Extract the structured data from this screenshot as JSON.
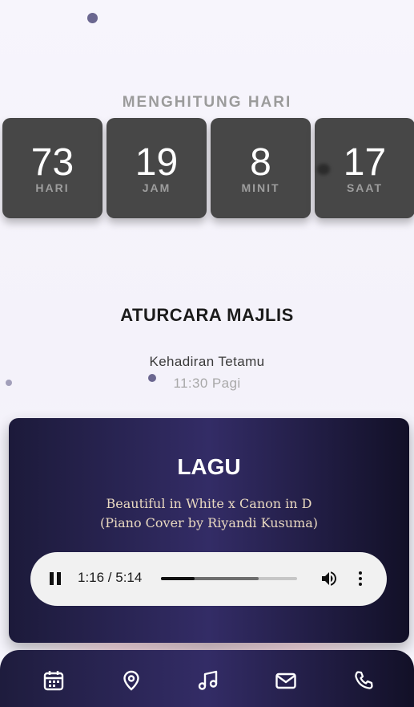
{
  "countdown": {
    "title": "MENGHITUNG HARI",
    "units": [
      {
        "value": "73",
        "label": "HARI"
      },
      {
        "value": "19",
        "label": "JAM"
      },
      {
        "value": "8",
        "label": "MINIT"
      },
      {
        "value": "17",
        "label": "SAAT"
      }
    ]
  },
  "schedule": {
    "title": "ATURCARA MAJLIS",
    "event_name": "Kehadiran Tetamu",
    "event_time": "11:30 Pagi"
  },
  "music": {
    "title": "LAGU",
    "song_line1": "Beautiful in White x Canon in D",
    "song_line2": "(Piano Cover by Riyandi Kusuma)",
    "time_display": "1:16 / 5:14",
    "progress": 0.245,
    "buffered": 0.72
  },
  "bottom_nav": {
    "items": [
      "calendar-icon",
      "location-pin-icon",
      "music-note-icon",
      "mail-icon",
      "phone-icon"
    ]
  }
}
